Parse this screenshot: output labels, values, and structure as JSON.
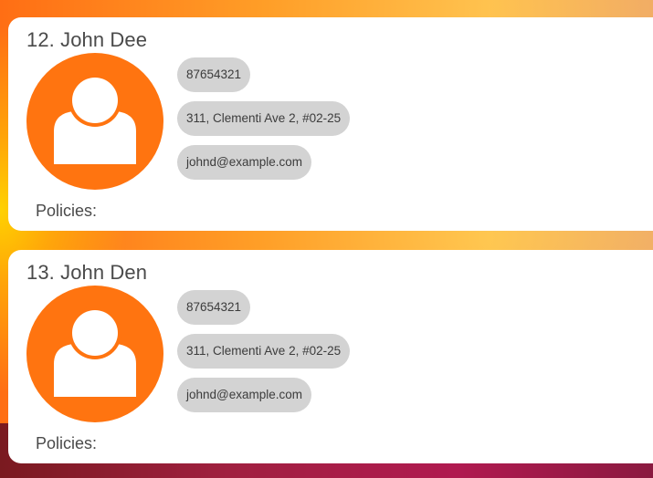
{
  "contacts": [
    {
      "title": "12. John Dee",
      "phone": "87654321",
      "address": "311, Clementi Ave 2, #02-25",
      "email": "johnd@example.com",
      "policies_label": "Policies:"
    },
    {
      "title": "13. John Den",
      "phone": "87654321",
      "address": "311, Clementi Ave 2, #02-25",
      "email": "johnd@example.com",
      "policies_label": "Policies:"
    }
  ],
  "colors": {
    "avatar_bg": "#ff7410",
    "chip_bg": "#d3d3d3",
    "card_bg": "#ffffff"
  },
  "icons": {
    "avatar": "user-silhouette-icon"
  }
}
